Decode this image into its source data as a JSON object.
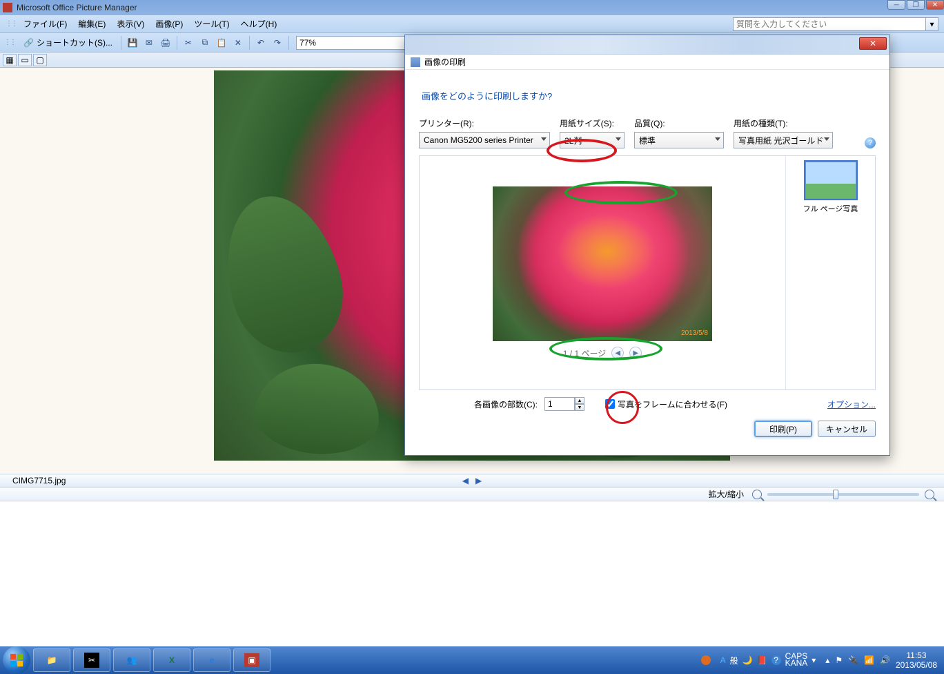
{
  "app": {
    "title": "Microsoft Office Picture Manager"
  },
  "menus": {
    "file": "ファイル(F)",
    "edit": "編集(E)",
    "view": "表示(V)",
    "image": "画像(P)",
    "tools": "ツール(T)",
    "help": "ヘルプ(H)"
  },
  "help_placeholder": "質問を入力してください",
  "toolbar": {
    "shortcut": "ショートカット(S)...",
    "zoom_value": "77%"
  },
  "filename": "CIMG7715.jpg",
  "zoom_bar_label": "拡大/縮小",
  "dialog": {
    "title": "画像の印刷",
    "question": "画像をどのように印刷しますか?",
    "printer_label": "プリンター(R):",
    "printer_value": "Canon MG5200 series Printer",
    "paper_size_label": "用紙サイズ(S):",
    "paper_size_value": "2L判",
    "quality_label": "品質(Q):",
    "quality_value": "標準",
    "paper_type_label": "用紙の種類(T):",
    "paper_type_value": "写真用紙 光沢ゴールド",
    "pager": "1 / 1 ページ",
    "layout_fullpage": "フル ページ写真",
    "copies_label": "各画像の部数(C):",
    "copies_value": "1",
    "fit_label": "写真をフレームに合わせる(F)",
    "options_link": "オプション...",
    "print_btn": "印刷(P)",
    "cancel_btn": "キャンセル",
    "preview_date": "2013/5/8"
  },
  "ime": {
    "a": "A",
    "han": "般",
    "caps": "CAPS",
    "kana": "KANA"
  },
  "clock": {
    "time": "11:53",
    "date": "2013/05/08"
  }
}
